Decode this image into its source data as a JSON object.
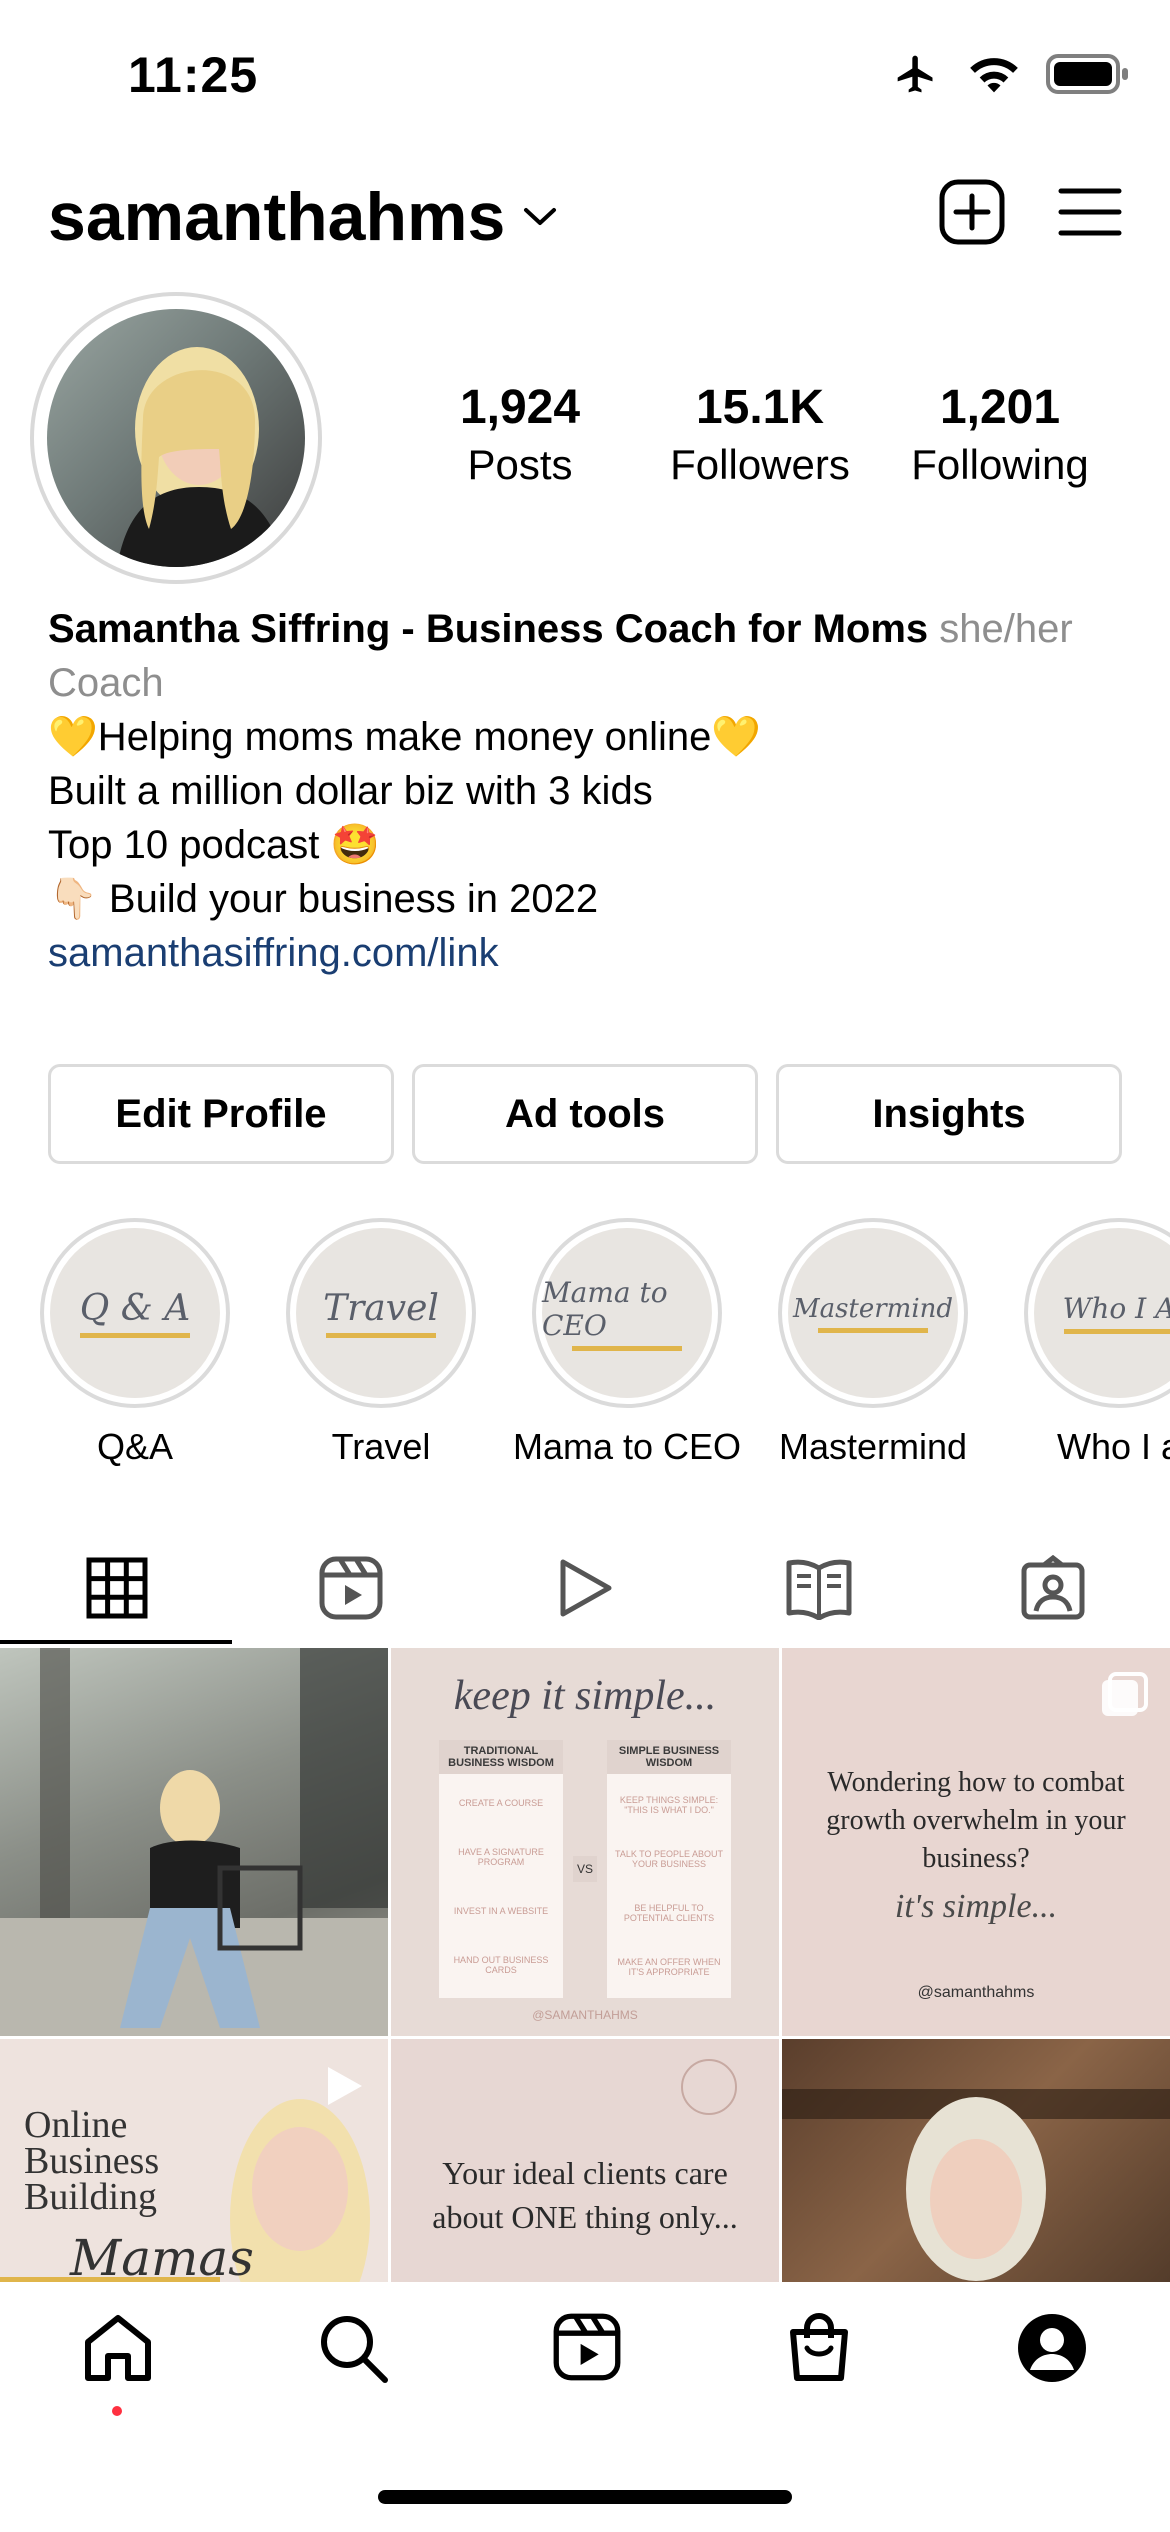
{
  "status_bar": {
    "time": "11:25"
  },
  "header": {
    "username": "samanthahms"
  },
  "profile": {
    "stats": [
      {
        "value": "1,924",
        "label": "Posts"
      },
      {
        "value": "15.1K",
        "label": "Followers"
      },
      {
        "value": "1,201",
        "label": "Following"
      }
    ],
    "bio": {
      "name": "Samantha Siffring - Business Coach for Moms",
      "pronouns": "she/her",
      "category": "Coach",
      "line1": "💛Helping moms make money online💛",
      "line2": "Built a million dollar biz with 3 kids",
      "line3": "Top 10 podcast 🤩",
      "line4": "👇🏻 Build your business in 2022",
      "link": "samanthasiffring.com/link"
    }
  },
  "buttons": {
    "edit_profile": "Edit Profile",
    "ad_tools": "Ad tools",
    "insights": "Insights"
  },
  "highlights": [
    {
      "label": "Q&A",
      "cover": "Q & A"
    },
    {
      "label": "Travel",
      "cover": "Travel"
    },
    {
      "label": "Mama to CEO",
      "cover": "Mama to CEO"
    },
    {
      "label": "Mastermind",
      "cover": "Mastermind"
    },
    {
      "label": "Who I a",
      "cover": "Who I A"
    }
  ],
  "grid": {
    "post2": {
      "title": "keep it simple...",
      "left_heading": "TRADITIONAL BUSINESS WISDOM",
      "right_heading": "SIMPLE BUSINESS WISDOM",
      "left_items": [
        "CREATE A COURSE",
        "HAVE A SIGNATURE PROGRAM",
        "INVEST IN A WEBSITE",
        "HAND OUT BUSINESS CARDS"
      ],
      "right_items": [
        "KEEP THINGS SIMPLE: \"THIS IS WHAT I DO.\"",
        "TALK TO PEOPLE ABOUT YOUR BUSINESS",
        "BE HELPFUL TO POTENTIAL CLIENTS",
        "MAKE AN OFFER WHEN IT'S APPROPRIATE"
      ],
      "vs": "VS",
      "handle": "@SAMANTHAHMS"
    },
    "post3": {
      "text": "Wondering how to combat growth overwhelm in your business?",
      "script": "it's simple...",
      "handle": "@samanthahms"
    },
    "post4": {
      "text": "Online Business Building",
      "script": "Mamas"
    },
    "post5": {
      "text": "Your ideal clients care about ONE thing only..."
    }
  }
}
